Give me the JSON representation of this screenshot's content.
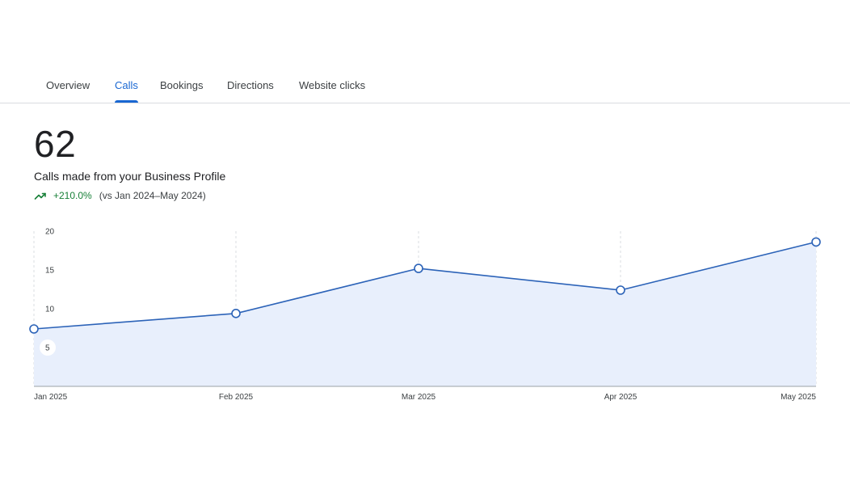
{
  "tabs": [
    {
      "label": "Overview",
      "active": false
    },
    {
      "label": "Calls",
      "active": true
    },
    {
      "label": "Bookings",
      "active": false
    },
    {
      "label": "Directions",
      "active": false
    },
    {
      "label": "Website clicks",
      "active": false
    }
  ],
  "summary": {
    "total": "62",
    "label": "Calls made from your Business Profile",
    "change": "+210.0%",
    "comparison": "(vs Jan 2024–May 2024)",
    "trend_icon": "trending-up-icon"
  },
  "colors": {
    "accent": "#1967d2",
    "line": "#2c63b8",
    "area": "#e8effc",
    "positive": "#188038"
  },
  "chart_data": {
    "type": "area",
    "categories": [
      "Jan 2025",
      "Feb 2025",
      "Mar 2025",
      "Apr 2025",
      "May 2025"
    ],
    "series": [
      {
        "values": [
          7.4,
          9.4,
          15.2,
          12.4,
          18.6
        ]
      }
    ],
    "ylim": [
      0,
      20
    ],
    "yticks": [
      5,
      10,
      15,
      20
    ],
    "grid": "vertical-dashed",
    "legend": "none"
  }
}
